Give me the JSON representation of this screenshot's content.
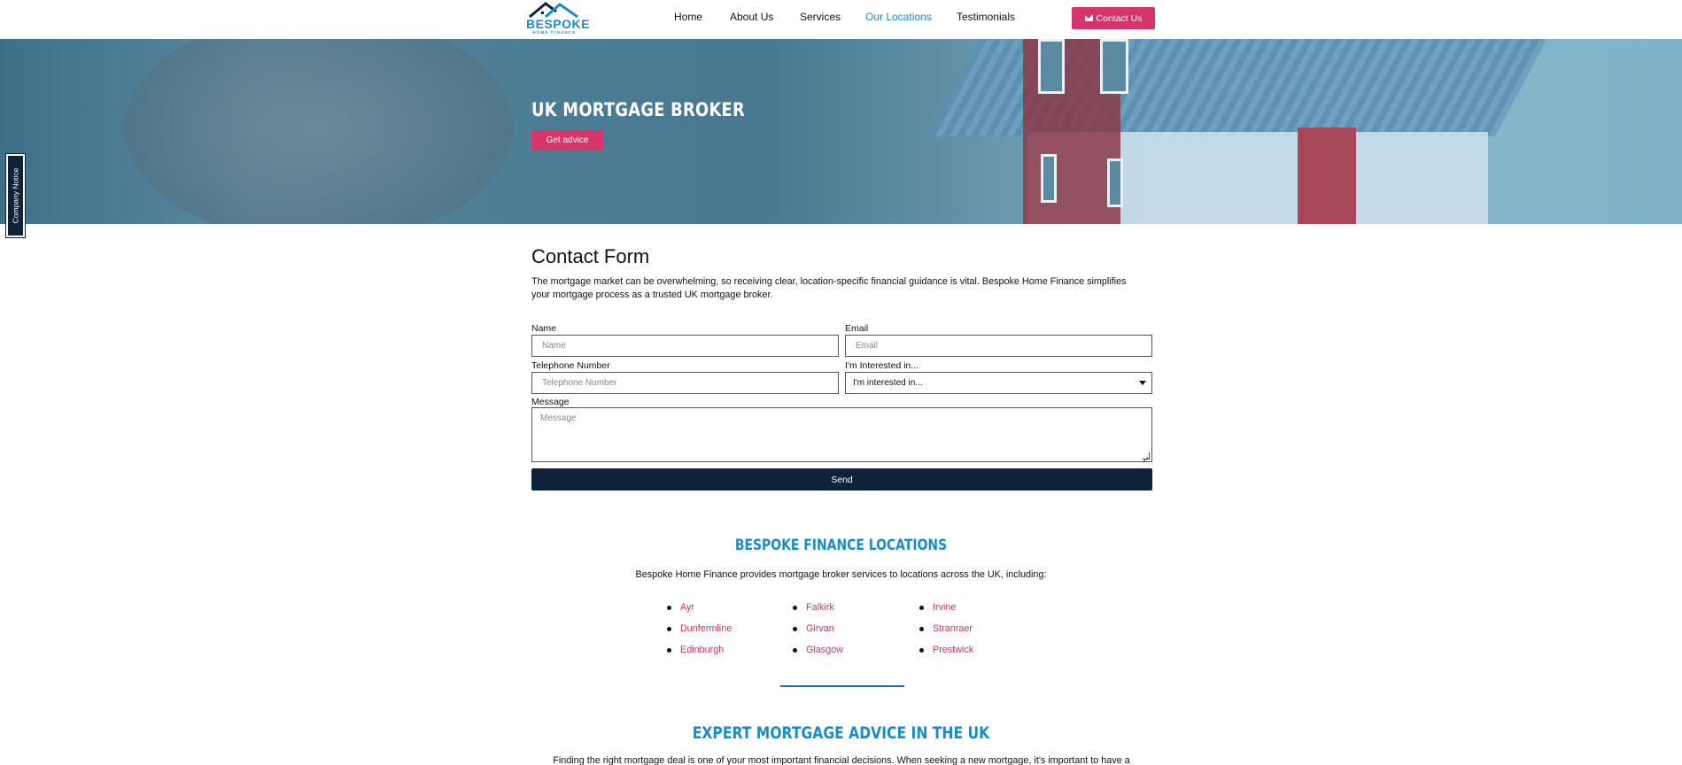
{
  "header": {
    "logo": {
      "text": "BESPOKE",
      "subtext": "HOME FINANCE"
    },
    "nav": [
      {
        "label": "Home",
        "active": false
      },
      {
        "label": "About Us",
        "active": false
      },
      {
        "label": "Services",
        "active": false
      },
      {
        "label": "Our Locations",
        "active": true
      },
      {
        "label": "Testimonials",
        "active": false
      }
    ],
    "contact_button": {
      "label": "Contact Us",
      "icon": "envelope-icon"
    }
  },
  "hero": {
    "title": "UK MORTGAGE BROKER",
    "button_label": "Get advice"
  },
  "side_tab": {
    "label": "Company Notice"
  },
  "contact_form": {
    "title": "Contact Form",
    "description": "The mortgage market can be overwhelming, so receiving clear, location-specific financial guidance is vital. Bespoke Home Finance simplifies your mortgage process as a trusted UK mortgage broker.",
    "fields": {
      "name": {
        "label": "Name",
        "placeholder": "Name"
      },
      "email": {
        "label": "Email",
        "placeholder": "Email"
      },
      "phone": {
        "label": "Telephone Number",
        "placeholder": "Telephone Number"
      },
      "interest": {
        "label": "I'm Interested in...",
        "selected": "I'm interested in..."
      },
      "message": {
        "label": "Message",
        "placeholder": "Message"
      }
    },
    "send_label": "Send"
  },
  "locations": {
    "title": "BESPOKE FINANCE LOCATIONS",
    "description": "Bespoke Home Finance provides mortgage broker services to locations across the UK, including:",
    "columns": [
      [
        "Ayr",
        "Dunfermline",
        "Edinburgh"
      ],
      [
        "Falkirk",
        "Girvan",
        "Glasgow"
      ],
      [
        "Irvine",
        "Stranraer",
        "Prestwick"
      ]
    ]
  },
  "expert": {
    "title": "EXPERT MORTGAGE ADVICE IN THE UK",
    "text": "Finding the right mortgage deal is one of your most important financial decisions. When seeking a new mortgage, it's important to have a"
  },
  "colors": {
    "accent_pink": "#d4356b",
    "brand_blue": "#1a8bc9",
    "navy": "#0e223a"
  }
}
